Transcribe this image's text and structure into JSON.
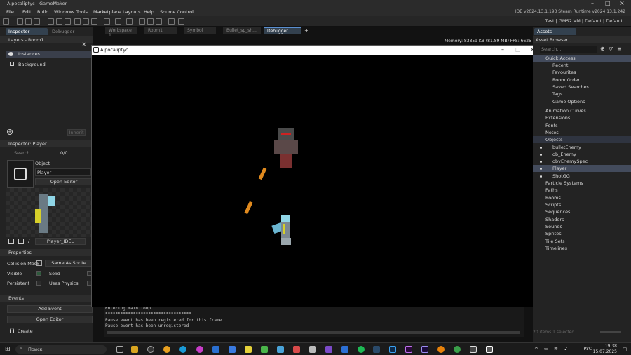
{
  "window": {
    "title": "Aipocaliptyc - GameMaker"
  },
  "menu": [
    "File",
    "Edit",
    "Build",
    "Windows",
    "Tools",
    "Marketplace",
    "Layouts",
    "Help",
    "Source Control"
  ],
  "ide_version": "IDE v2024.13.1.193  Steam  Runtime v2024.13.1.242",
  "toolbar_right": "Test  |  GMS2 VM  |  Default  |  Default",
  "left_tabs": {
    "inspector": "Inspector",
    "debugger": "Debugger"
  },
  "layers": {
    "title": "Layers - Room1",
    "items": [
      "Instances",
      "Background"
    ],
    "inherit_button": "Inherit"
  },
  "inspector": {
    "title": "Inspector: Player",
    "search_placeholder": "Search...",
    "count": "0/0",
    "object_label": "Object",
    "object_name": "Player",
    "open_editor": "Open Editor",
    "sprite_name": "Player_IDEL",
    "properties_header": "Properties",
    "collision_mask": "Collision Mask",
    "same_as_sprite": "Same As Sprite",
    "visible": "Visible",
    "solid": "Solid",
    "persistent": "Persistent",
    "uses_physics": "Uses Physics",
    "events_header": "Events",
    "add_event": "Add Event",
    "open_editor_2": "Open Editor",
    "create_event": "Create"
  },
  "doc_tabs": [
    "Workspace 1",
    "Room1",
    "Symbol",
    "Bullet_sp_sh...",
    "Debugger"
  ],
  "memory": "Memory: 83859 KB (81.89 MB)  FPS: 6625",
  "game_window": {
    "title": "Aipocaliptyc"
  },
  "console_lines": [
    "Entering main loop.",
    "**********************************",
    "Pause event has been registered for this frame",
    "Pause event has been unregistered"
  ],
  "assets": {
    "tab": "Assets",
    "title": "Asset Browser",
    "search_placeholder": "Search...",
    "quick_access": [
      "Quick Access",
      "Recent",
      "Favourites",
      "Room Order",
      "Saved Searches",
      "Tags",
      "Game Options"
    ],
    "groups": [
      "Animation Curves",
      "Extensions",
      "Fonts",
      "Notes",
      "Objects"
    ],
    "objects": [
      "bulletEnemy",
      "ob_Enemy",
      "obvEnemySpec",
      "Player",
      "ShotGG"
    ],
    "groups2": [
      "Particle Systems",
      "Paths",
      "Rooms",
      "Scripts",
      "Sequences",
      "Shaders",
      "Sounds",
      "Sprites",
      "Tile Sets",
      "Timelines"
    ],
    "status": "20 items  1 selected"
  },
  "taskbar": {
    "search": "Поиск",
    "lang": "РУС",
    "time": "19:38",
    "date": "15.07.2025"
  },
  "colors": {
    "bullet": "#e08a1e",
    "selection": "#434b5c",
    "accent": "#5a8fd0"
  }
}
